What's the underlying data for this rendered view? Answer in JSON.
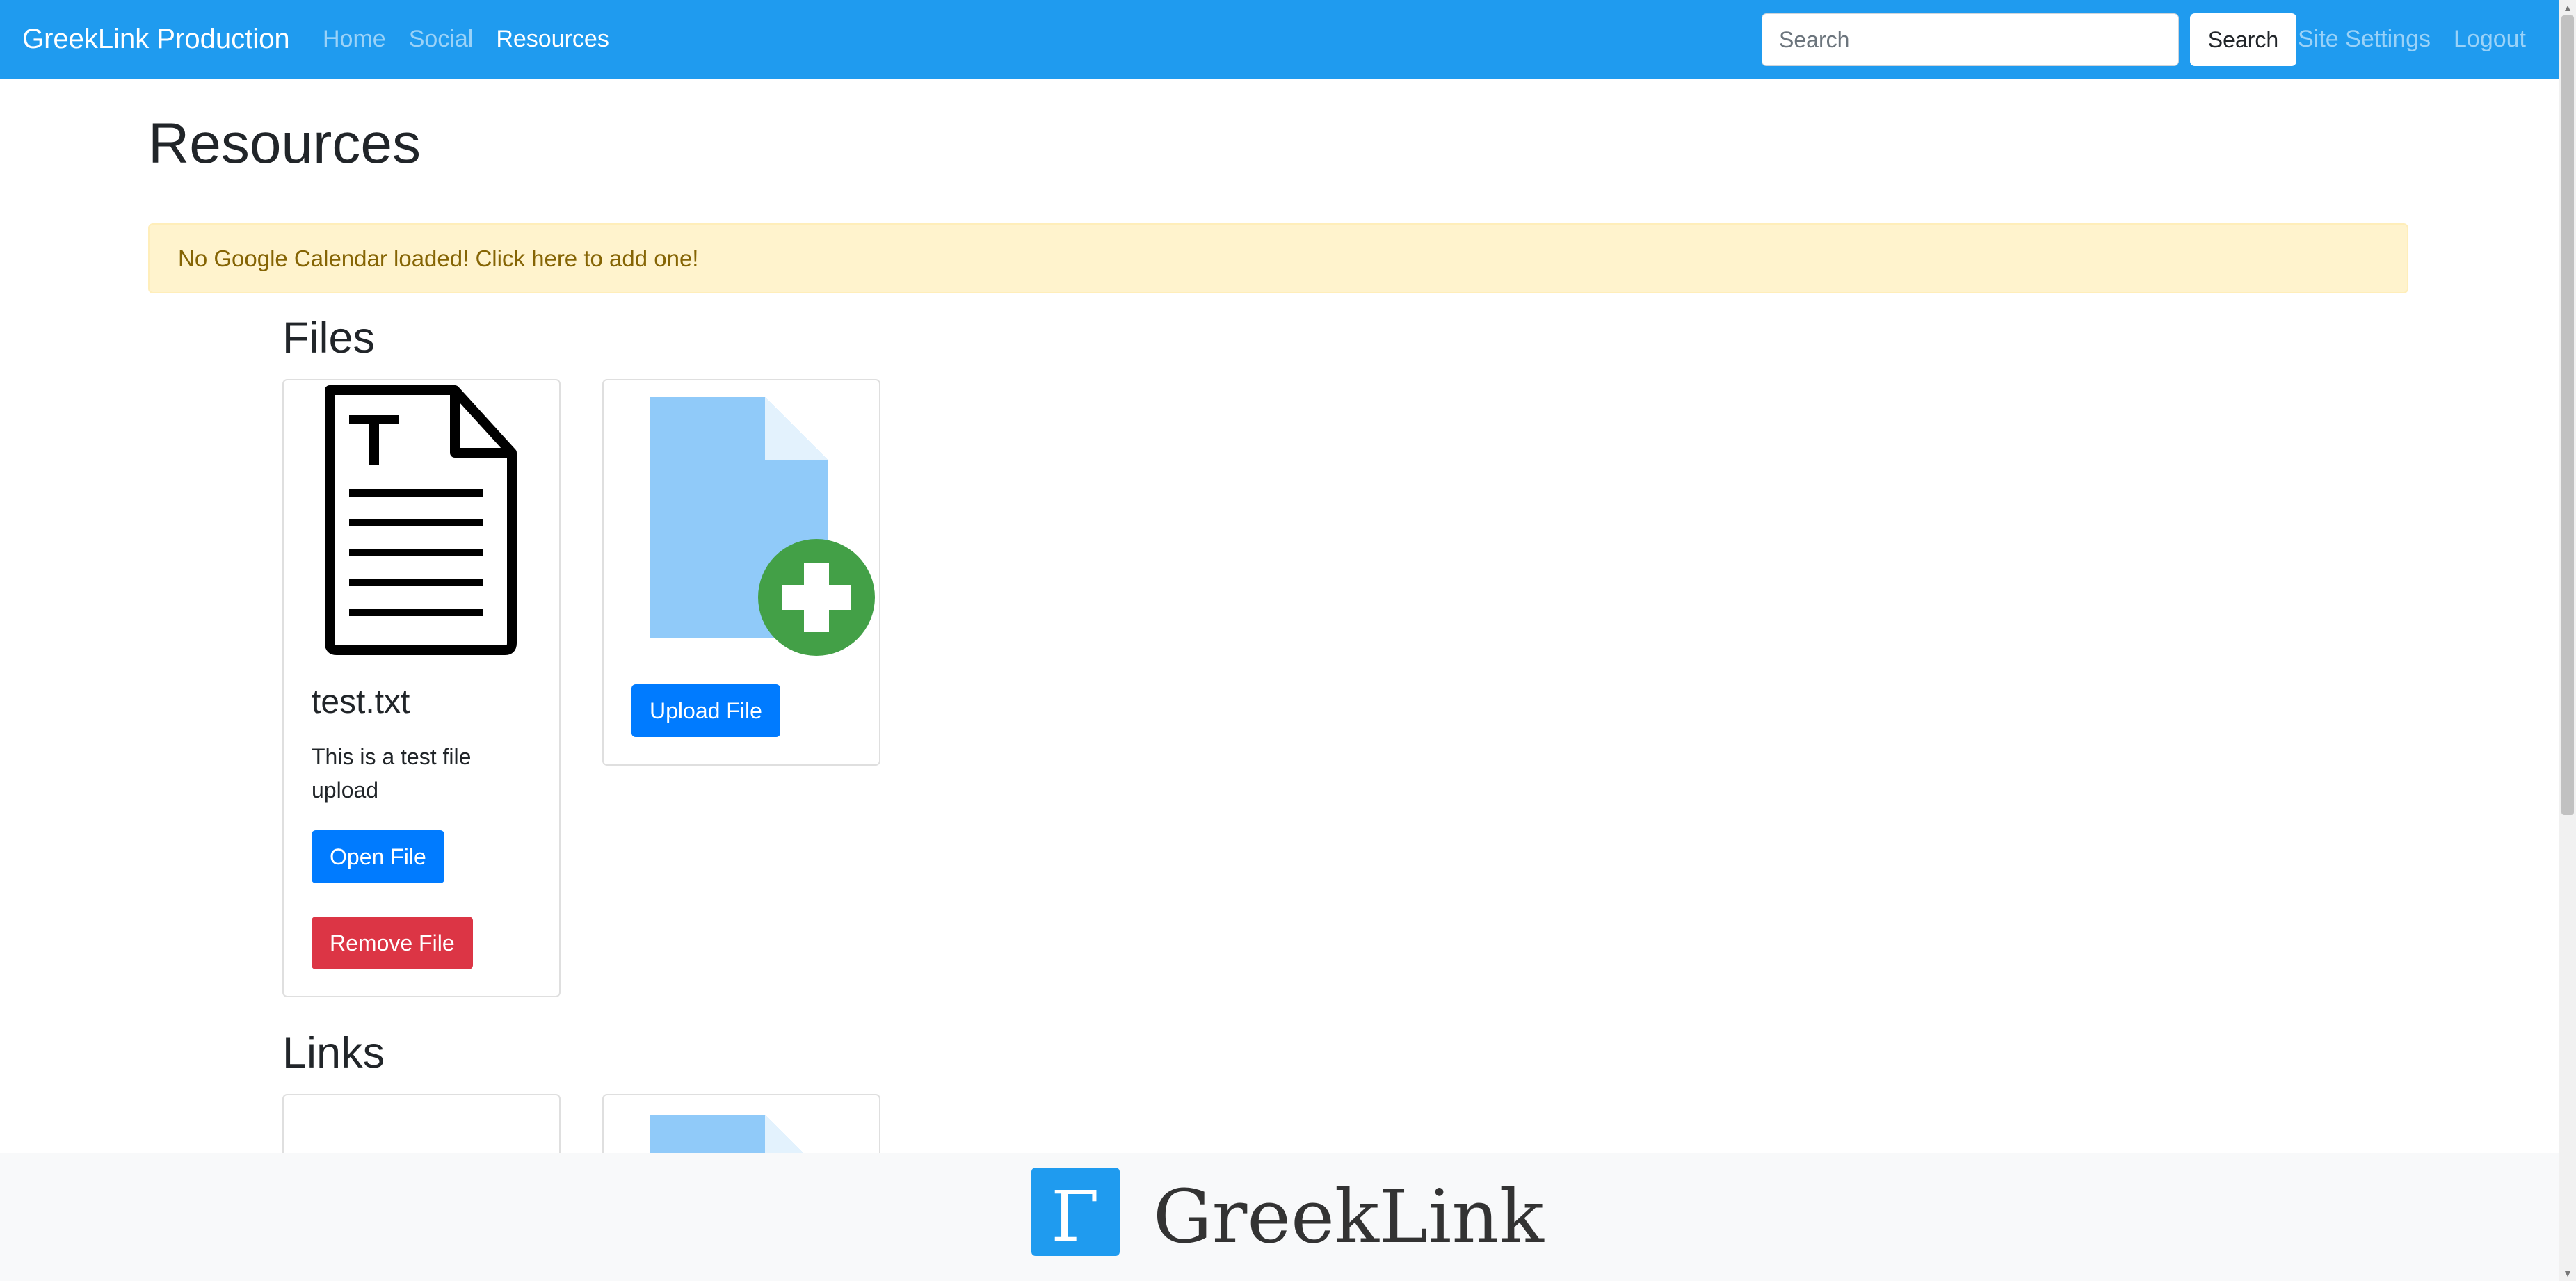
{
  "navbar": {
    "brand": "GreekLink Production",
    "links": [
      {
        "label": "Home"
      },
      {
        "label": "Social"
      },
      {
        "label": "Resources"
      }
    ],
    "search_placeholder": "Search",
    "search_button": "Search",
    "right_links": [
      {
        "label": "Site Settings"
      },
      {
        "label": "Logout"
      }
    ]
  },
  "main": {
    "title": "Resources",
    "alert": "No Google Calendar loaded! Click here to add one!",
    "files": {
      "heading": "Files",
      "cards": [
        {
          "icon": "text-file-icon",
          "title": "test.txt",
          "description": "This is a test file upload",
          "open_label": "Open File",
          "remove_label": "Remove File"
        },
        {
          "icon": "add-file-icon",
          "upload_label": "Upload File"
        }
      ]
    },
    "links": {
      "heading": "Links"
    }
  },
  "footer": {
    "logo_letter": "Γ",
    "brand": "GreekLink"
  },
  "colors": {
    "navbar": "#1f9bef",
    "primary": "#007bff",
    "danger": "#dc3545",
    "alert_bg": "#fff3cd",
    "alert_text": "#856404",
    "add_green": "#43a047",
    "file_blue": "#90caf9"
  }
}
